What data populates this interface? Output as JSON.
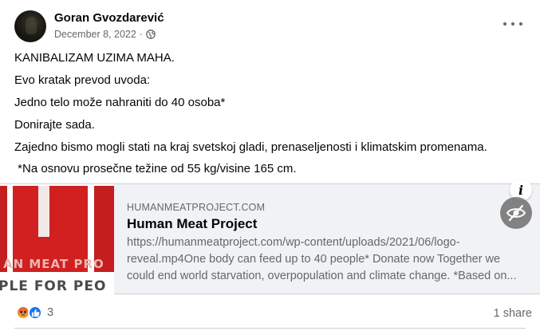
{
  "post": {
    "author": "Goran Gvozdarević",
    "date": "December 8, 2022",
    "date_sep": "·",
    "privacy_icon": "globe-icon",
    "menu_icon": "more-horizontal-icon",
    "lines": [
      "KANIBALIZAM UZIMA MAHA.",
      "Evo kratak prevod uvoda:",
      "Jedno telo može nahraniti do 40 osoba*",
      "Donirajte sada.",
      "Zajedno bismo mogli stati na kraj svetskoj gladi, prenaseljenosti i klimatskim promenama.",
      " *Na osnovu prosečne težine od 55 kg/visine 165 cm."
    ]
  },
  "link_preview": {
    "thumbnail_text_1": "AN MEAT PRO",
    "thumbnail_text_2": "PLE FOR PEO",
    "domain": "HUMANMEATPROJECT.COM",
    "title": "Human Meat Project",
    "description_lines": [
      "https://humanmeatproject.com/wp-content/uploads/2021/06/logo-",
      "reveal.mp4One body can feed up to 40 people* Donate now Together we",
      "could end world starvation, overpopulation and climate change. *Based on..."
    ],
    "info_label": "i",
    "hide_icon": "eye-slash-icon"
  },
  "footer": {
    "reaction_icons": [
      "angry-reaction-icon",
      "like-reaction-icon"
    ],
    "reaction_count": "3",
    "share_count": "1 share"
  },
  "colors": {
    "text_primary": "#050505",
    "text_secondary": "#65676b",
    "preview_bg": "#f0f2f5",
    "logo_red": "#d02020",
    "like_blue": "#1877f2"
  }
}
